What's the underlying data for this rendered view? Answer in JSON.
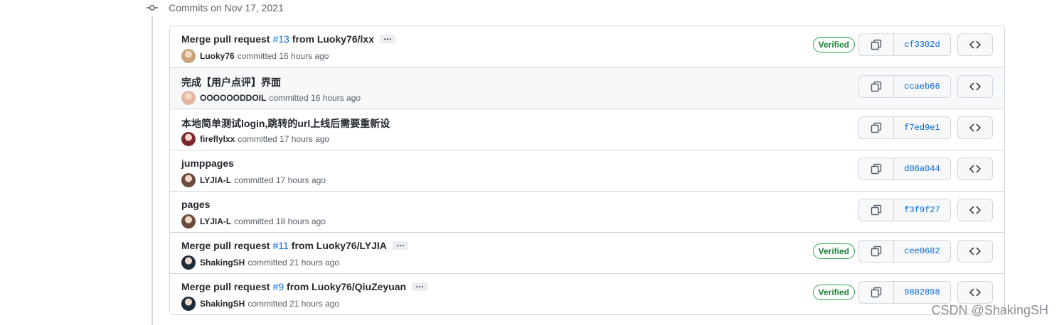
{
  "date_header": "Commits on Nov 17, 2021",
  "watermark": "CSDN @ShakingSH",
  "colors": {
    "link": "#0969da",
    "verified": "#1a7f37",
    "border": "#d0d7de",
    "hover_bg": "#f6f8fa"
  },
  "commits": [
    {
      "title_pre": "Merge pull request",
      "pr": "#13",
      "title_post": "from Luoky76/lxx",
      "has_ellipsis": true,
      "author": "Luoky76",
      "time_text": "committed 16 hours ago",
      "verified": "Verified",
      "sha": "cf3302d",
      "avatar_color": "#c9a27a"
    },
    {
      "title_pre": "完成【用户点评】界面",
      "pr": "",
      "title_post": "",
      "has_ellipsis": false,
      "author": "OOOOOODDOIL",
      "time_text": "committed 16 hours ago",
      "verified": "",
      "sha": "ccaeb66",
      "avatar_color": "#e2b6a2"
    },
    {
      "title_pre": "本地简单测试login,跳转的url上线后需要重新设",
      "pr": "",
      "title_post": "",
      "has_ellipsis": false,
      "author": "fireflylxx",
      "time_text": "committed 17 hours ago",
      "verified": "",
      "sha": "f7ed9e1",
      "avatar_color": "#7a2a2e"
    },
    {
      "title_pre": "jumppages",
      "pr": "",
      "title_post": "",
      "has_ellipsis": false,
      "author": "LYJIA-L",
      "time_text": "committed 17 hours ago",
      "verified": "",
      "sha": "d08a044",
      "avatar_color": "#6b4b3e"
    },
    {
      "title_pre": "pages",
      "pr": "",
      "title_post": "",
      "has_ellipsis": false,
      "author": "LYJIA-L",
      "time_text": "committed 18 hours ago",
      "verified": "",
      "sha": "f3f9f27",
      "avatar_color": "#6b4b3e"
    },
    {
      "title_pre": "Merge pull request",
      "pr": "#11",
      "title_post": "from Luoky76/LYJIA",
      "has_ellipsis": true,
      "author": "ShakingSH",
      "time_text": "committed 21 hours ago",
      "verified": "Verified",
      "sha": "cee0682",
      "avatar_color": "#1f2d3a"
    },
    {
      "title_pre": "Merge pull request",
      "pr": "#9",
      "title_post": "from Luoky76/QiuZeyuan",
      "has_ellipsis": true,
      "author": "ShakingSH",
      "time_text": "committed 21 hours ago",
      "verified": "Verified",
      "sha": "9882898",
      "avatar_color": "#1f2d3a"
    }
  ]
}
